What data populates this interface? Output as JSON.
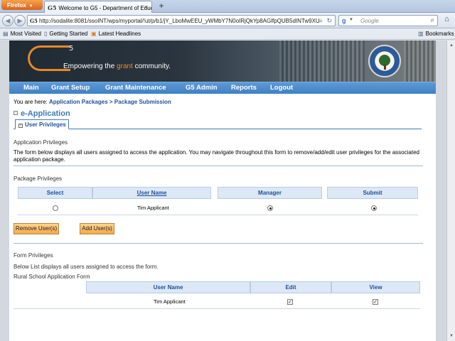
{
  "browser": {
    "app_button": "Firefox",
    "tab_title": "Welcome to G5 - Department of Educati...",
    "tab_icon_text": "G5",
    "url": "http://sodalite:8081/ssoINT/wps/myportal/!ut/p/b1/jY_LboMwEEU_yWMbY7N0oIRjQkYp8AGlfpQUB5dINTw9XU-",
    "search_placeholder": "Google",
    "bookmarks": [
      "Most Visited",
      "Getting Started",
      "Latest Headlines"
    ],
    "bookmarks_menu": "Bookmarks"
  },
  "banner": {
    "logo_sup": "5",
    "tagline_pre": "Empowering the ",
    "tagline_accent": "grant",
    "tagline_post": " community."
  },
  "menu": [
    "Main",
    "Grant Setup",
    "Grant Maintenance",
    "G5 Admin",
    "Reports",
    "Logout"
  ],
  "breadcrumb": {
    "prefix": "You are here: ",
    "path": "Application Packages > Package Submission"
  },
  "page_title": "e-Application",
  "tab_label": "User Privileges",
  "app_privileges": {
    "title": "Application Privileges",
    "description": "The form below displays all users assigned to access the application. You may navigate throughout this form to remove/add/edit user privileges for the associated application package."
  },
  "package_privileges": {
    "title": "Package Privileges",
    "columns": [
      "Select",
      "User Name",
      "Manager",
      "Submit"
    ],
    "rows": [
      {
        "user": "Tim Applicant",
        "select": false,
        "manager": true,
        "submit": true
      }
    ],
    "buttons": {
      "remove": "Remove User(s)",
      "add": "Add User(s)"
    }
  },
  "form_privileges": {
    "title": "Form Privileges",
    "description": "Below List displays all users assigned to access the form.",
    "form_name": "Rural School Application Form",
    "columns": [
      "User Name",
      "Edit",
      "View"
    ],
    "rows": [
      {
        "user": "Tim Applicant",
        "edit": true,
        "view": true
      }
    ]
  },
  "colors": {
    "menu_blue": "#4a8acb",
    "title_blue": "#3d7ab8",
    "link_blue": "#1f4f9c",
    "accent_orange": "#f28a1e",
    "button_orange": "#f4a950"
  }
}
